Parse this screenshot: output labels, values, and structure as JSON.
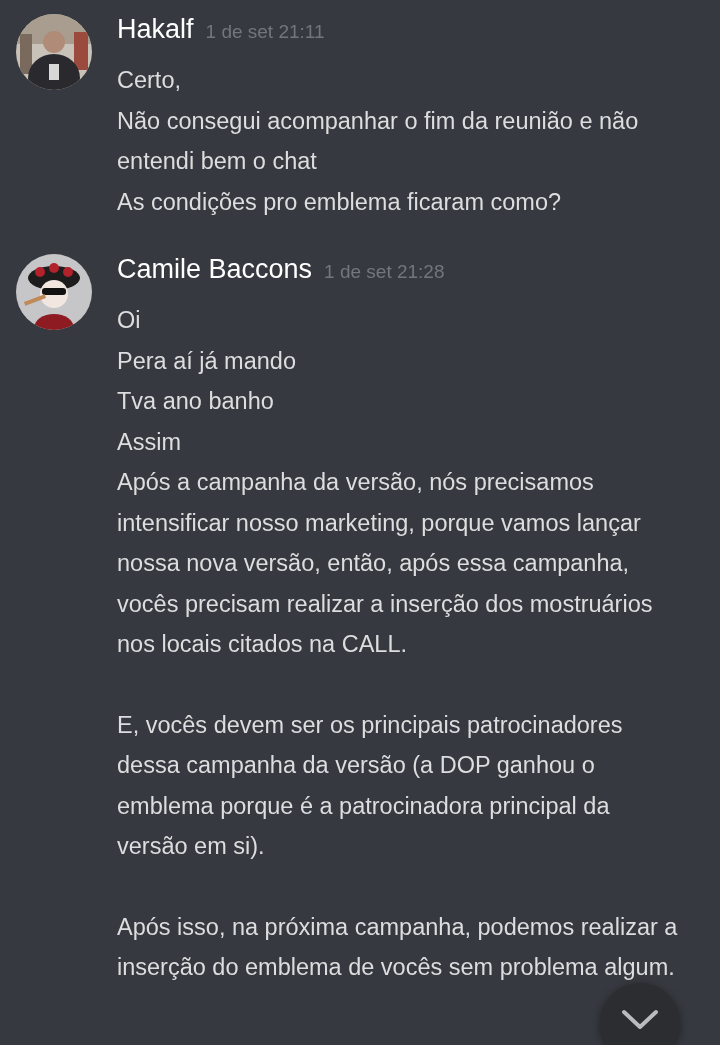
{
  "messages": [
    {
      "author": "Hakalf",
      "timestamp": "1 de set 21:11",
      "avatar": {
        "kind": "picture"
      },
      "blocks": [
        [
          "Certo,",
          "Não consegui acompanhar o fim da reunião e não entendi bem o chat",
          "As condições pro emblema ficaram como?"
        ]
      ]
    },
    {
      "author": "Camile Baccons",
      "timestamp": "1 de set 21:28",
      "avatar": {
        "kind": "picture"
      },
      "blocks": [
        [
          "Oi",
          "Pera aí já mando",
          "Tva ano banho",
          "Assim",
          "Após a campanha da versão, nós precisamos intensificar nosso marketing, porque vamos lançar nossa nova versão, então, após essa campanha, vocês precisam realizar a inserção dos mostruários nos locais citados na CALL."
        ],
        [
          "E, vocês devem ser os principais patrocinadores dessa campanha da versão (a DOP ganhou o emblema porque é a patrocinadora principal da versão em si)."
        ],
        [
          "Após isso, na próxima campanha, podemos realizar a inserção do emblema de vocês sem problema algum."
        ]
      ]
    }
  ]
}
